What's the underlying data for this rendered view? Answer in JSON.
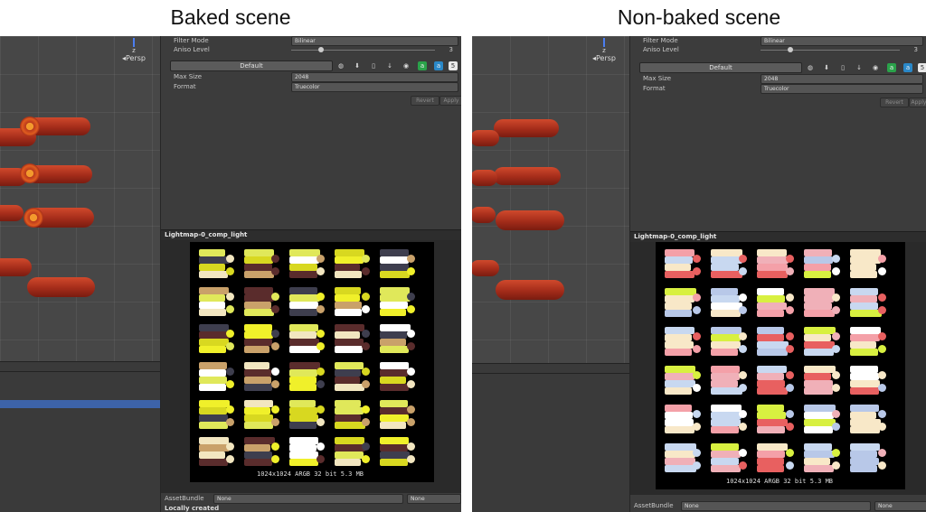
{
  "titles": {
    "left": "Baked scene",
    "right": "Non-baked scene"
  },
  "scene_view": {
    "gizmo_axis": "z",
    "projection": "Persp"
  },
  "inspector": {
    "filter_mode_label": "Filter Mode",
    "filter_mode_value": "Bilinear",
    "aniso_label": "Aniso Level",
    "aniso_value": "3",
    "default_tab": "Default",
    "platform_icons": [
      "globe-icon",
      "download-icon",
      "phone-icon",
      "arrow-down-icon",
      "eye-icon",
      "android-icon",
      "store-icon",
      "html5-icon"
    ],
    "max_size_label": "Max Size",
    "max_size_value": "2048",
    "format_label": "Format",
    "format_value": "Truecolor",
    "revert": "Revert",
    "apply": "Apply",
    "preview_title": "Lightmap-0_comp_light",
    "texture_info": "1024x1024  ARGB 32 bit  5.3 MB",
    "assetbundle_label": "AssetBundle",
    "assetbundle_value": "None",
    "assetbundle_variant": "None",
    "status": "Locally created"
  },
  "colors": {
    "baked": [
      "#f0f02a",
      "#d8d820",
      "#5a2c2c",
      "#3e3e4e",
      "#f2e6c0",
      "#c9a16a",
      "#ffffff",
      "#e0e85a"
    ],
    "nonbaked": [
      "#f4a0a8",
      "#c8d8f0",
      "#d8f040",
      "#f8e8c8",
      "#e86060",
      "#ffffff",
      "#b8c8e8",
      "#f0b0b8"
    ]
  }
}
